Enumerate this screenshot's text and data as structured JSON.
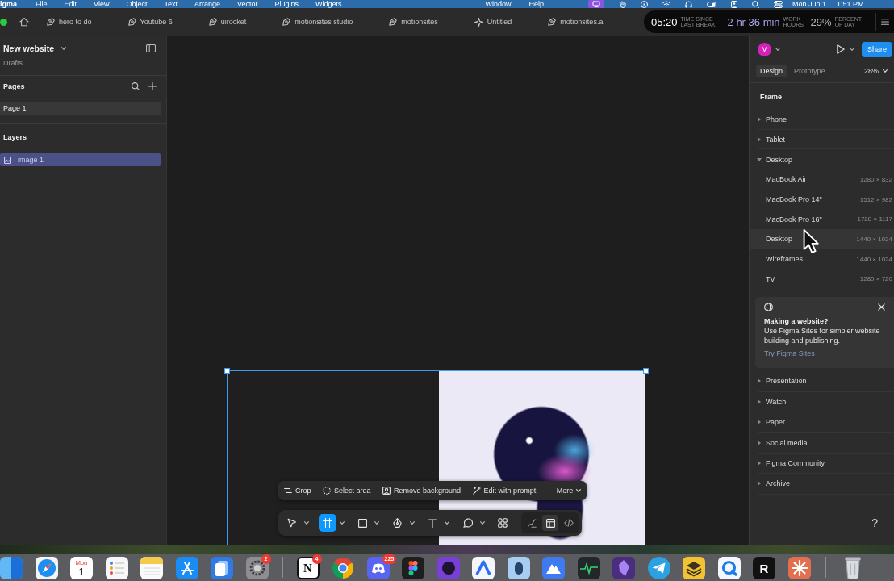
{
  "menu_bar": {
    "app": "igma",
    "menus": [
      "File",
      "Edit",
      "View",
      "Object",
      "Text",
      "Arrange",
      "Vector",
      "Plugins",
      "Widgets"
    ],
    "window_menus": [
      "Window",
      "Help"
    ],
    "date": "Mon Jun 1",
    "time": "1:51 PM"
  },
  "tab_bar": {
    "tabs": [
      {
        "label": "hero to do",
        "kind": "design",
        "selected": false
      },
      {
        "label": "Youtube 6",
        "kind": "design",
        "selected": false
      },
      {
        "label": "uirocket",
        "kind": "design",
        "selected": false
      },
      {
        "label": "motionsites studio",
        "kind": "design",
        "selected": false
      },
      {
        "label": "motionsites",
        "kind": "design",
        "selected": false
      },
      {
        "label": "Untitled",
        "kind": "slides",
        "selected": false
      },
      {
        "label": "motionsites.ai",
        "kind": "design",
        "selected": false
      }
    ],
    "timer": {
      "break_time": "05:20",
      "break_caption": "TIME SINCE LAST BREAK",
      "work_time": "2 hr 36 min",
      "work_caption": "WORK HOURS",
      "day_percent": "29%",
      "day_caption": "PERCENT OF DAY"
    }
  },
  "left_panel": {
    "file_name": "New website",
    "location": "Drafts",
    "pages_title": "Pages",
    "pages": [
      {
        "label": "Page 1",
        "selected": true
      }
    ],
    "layers_title": "Layers",
    "layers": [
      {
        "label": "image 1",
        "kind": "image",
        "selected": true
      }
    ]
  },
  "canvas": {
    "frame": {
      "selected": true
    }
  },
  "image_actions": [
    {
      "label": "Crop",
      "kind": "crop"
    },
    {
      "label": "Select area",
      "kind": "select"
    },
    {
      "label": "Remove background",
      "kind": "remove"
    },
    {
      "label": "Edit with prompt",
      "kind": "prompt"
    },
    {
      "label": "More",
      "kind": "more"
    }
  ],
  "toolbar": {
    "tools": [
      {
        "kind": "move",
        "selected": false,
        "has_menu": true
      },
      {
        "kind": "frame",
        "selected": true,
        "has_menu": true
      },
      {
        "kind": "rectangle",
        "selected": false,
        "has_menu": true
      },
      {
        "kind": "pen",
        "selected": false,
        "has_menu": true
      },
      {
        "kind": "text",
        "selected": false,
        "has_menu": true
      },
      {
        "kind": "comment",
        "selected": false,
        "has_menu": true
      },
      {
        "kind": "actions",
        "selected": false,
        "has_menu": false
      }
    ],
    "modes": [
      {
        "kind": "draw",
        "selected": false
      },
      {
        "kind": "design",
        "selected": true
      },
      {
        "kind": "dev",
        "selected": false
      }
    ]
  },
  "right_panel": {
    "avatar": "V",
    "share": "Share",
    "tabs": [
      {
        "label": "Design",
        "selected": true
      },
      {
        "label": "Prototype",
        "selected": false
      }
    ],
    "zoom": "28%",
    "section_title": "Frame",
    "presets": [
      {
        "label": "Phone",
        "expanded": false
      },
      {
        "label": "Tablet",
        "expanded": false
      },
      {
        "label": "Desktop",
        "expanded": true,
        "children": [
          {
            "label": "MacBook Air",
            "size": "1280 × 832",
            "hovered": false
          },
          {
            "label": "MacBook Pro 14\"",
            "size": "1512 × 982",
            "hovered": false
          },
          {
            "label": "MacBook Pro 16\"",
            "size": "1728 × 1117",
            "hovered": false
          },
          {
            "label": "Desktop",
            "size": "1440 × 1024",
            "hovered": true
          },
          {
            "label": "Wireframes",
            "size": "1440 × 1024",
            "hovered": false
          },
          {
            "label": "TV",
            "size": "1280 × 720",
            "hovered": false
          }
        ]
      }
    ],
    "promo": {
      "title": "Making a website?",
      "body": "Use Figma Sites for simpler website building and publishing.",
      "link": "Try Figma Sites"
    },
    "more_presets": [
      {
        "label": "Presentation",
        "expanded": false
      },
      {
        "label": "Watch",
        "expanded": false
      },
      {
        "label": "Paper",
        "expanded": false
      },
      {
        "label": "Social media",
        "expanded": false
      },
      {
        "label": "Figma Community",
        "expanded": false
      },
      {
        "label": "Archive",
        "expanded": false
      }
    ],
    "help": "?"
  },
  "dock": {
    "groups": [
      {
        "apps": [
          {
            "kind": "finder"
          },
          {
            "kind": "compass"
          },
          {
            "kind": "calendar",
            "month": "Mon",
            "day": "1"
          },
          {
            "kind": "checklist"
          },
          {
            "kind": "notes"
          },
          {
            "kind": "store"
          },
          {
            "kind": "cards"
          },
          {
            "kind": "gear",
            "badge": "2"
          }
        ]
      },
      {
        "apps": [
          {
            "kind": "lightletter",
            "glyph": "N",
            "badge": "4"
          },
          {
            "kind": "tricolor"
          },
          {
            "kind": "controller",
            "badge": "225"
          },
          {
            "kind": "dots"
          },
          {
            "kind": "emblem"
          },
          {
            "kind": "arch"
          },
          {
            "kind": "capsule"
          },
          {
            "kind": "mountain"
          },
          {
            "kind": "pulse"
          },
          {
            "kind": "gem"
          },
          {
            "kind": "plane"
          },
          {
            "kind": "layers"
          },
          {
            "kind": "ring"
          },
          {
            "kind": "darkletter",
            "glyph": "R"
          },
          {
            "kind": "asterisk"
          }
        ]
      },
      {
        "apps": [
          {
            "kind": "trash"
          }
        ]
      }
    ]
  }
}
